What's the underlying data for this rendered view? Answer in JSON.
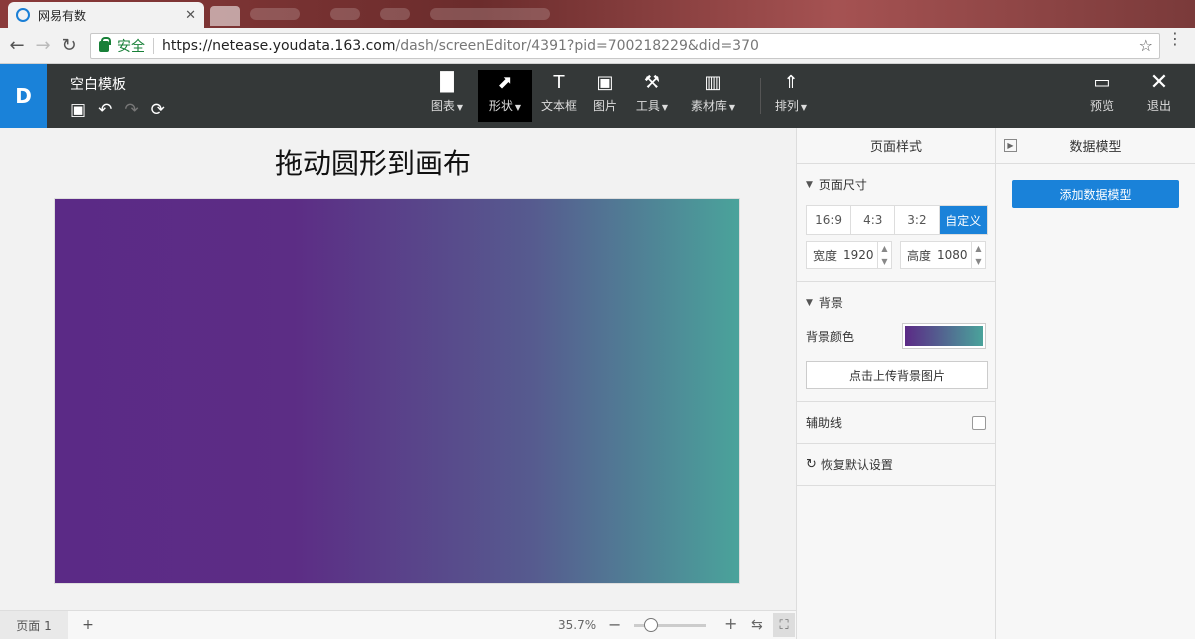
{
  "browser": {
    "tab_title": "网易有数",
    "tab_close": "✕",
    "security_label": "安全",
    "url_host": "https://netease.youdata.163.com",
    "url_path": "/dash/screenEditor/4391?pid=700218229&did=370"
  },
  "toolbar": {
    "doc_title": "空白模板",
    "tools": [
      {
        "label": "图表",
        "icon": "bar-chart-icon",
        "glyph": "▐▌",
        "caret": true
      },
      {
        "label": "形状",
        "icon": "shape-icon",
        "glyph": "⬈",
        "caret": true
      },
      {
        "label": "文本框",
        "icon": "textbox-icon",
        "glyph": "T",
        "caret": false
      },
      {
        "label": "图片",
        "icon": "image-icon",
        "glyph": "▣",
        "caret": false
      },
      {
        "label": "工具",
        "icon": "tool-icon",
        "glyph": "⚒",
        "caret": true
      },
      {
        "label": "素材库",
        "icon": "material-icon",
        "glyph": "▥",
        "caret": true
      },
      {
        "label": "排列",
        "icon": "arrange-icon",
        "glyph": "⇑",
        "caret": true
      }
    ],
    "preview_label": "预览",
    "exit_label": "退出"
  },
  "canvas": {
    "title": "拖动圆形到画布",
    "gradient_start": "#5b2a86",
    "gradient_end": "#4aa39b"
  },
  "bottombar": {
    "page_tab": "页面 1",
    "add_page": "+",
    "zoom": "35.7%",
    "zoom_minus": "−",
    "zoom_plus": "+"
  },
  "style_panel": {
    "header": "页面样式",
    "page_size": {
      "title": "页面尺寸",
      "ratios": [
        "16:9",
        "4:3",
        "3:2",
        "自定义"
      ],
      "active_ratio": "自定义",
      "width_label": "宽度",
      "width_value": "1920",
      "height_label": "高度",
      "height_value": "1080"
    },
    "background": {
      "title": "背景",
      "color_label": "背景颜色",
      "upload_label": "点击上传背景图片"
    },
    "guides_label": "辅助线",
    "reset_label": "恢复默认设置"
  },
  "model_panel": {
    "header": "数据模型",
    "add_button": "添加数据模型"
  },
  "colors": {
    "accent": "#1a82d9",
    "toolbar_bg": "#343838"
  }
}
